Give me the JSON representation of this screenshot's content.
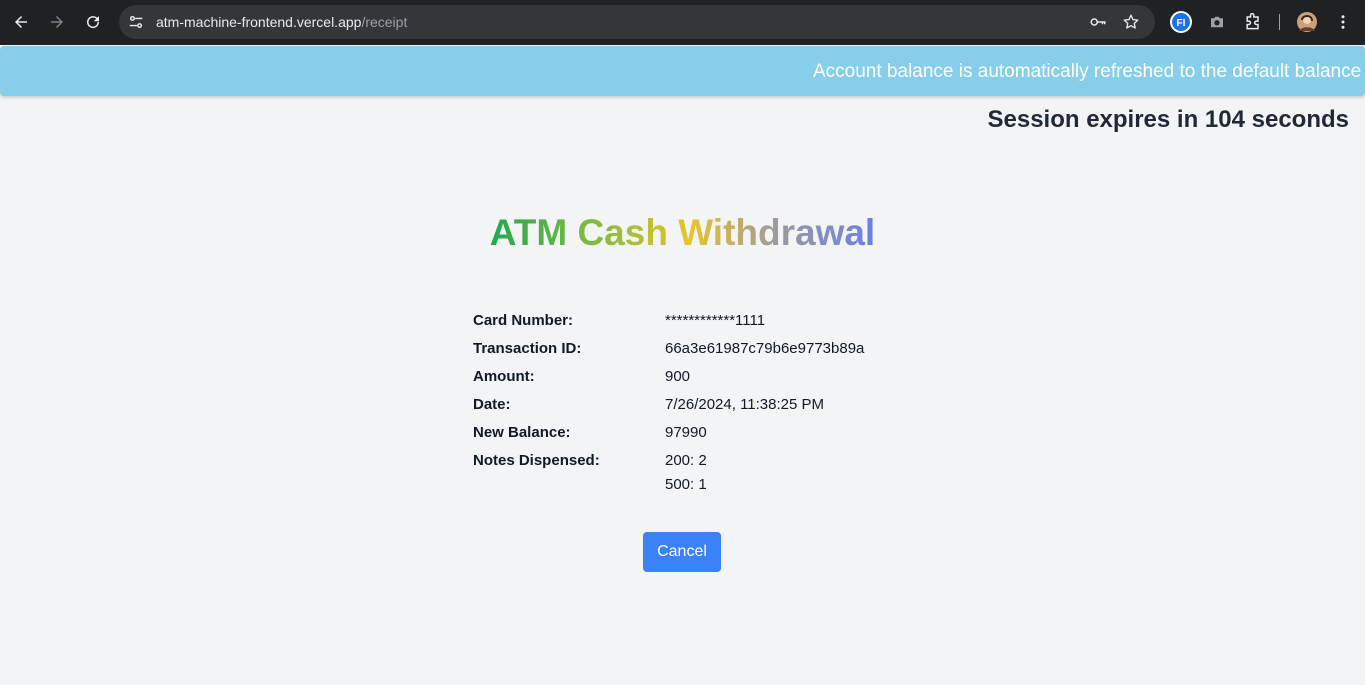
{
  "browser": {
    "url_host": "atm-machine-frontend.vercel.app",
    "url_path": "/receipt",
    "icons": [
      "back-icon",
      "forward-icon",
      "reload-icon",
      "site-info-icon",
      "key-icon",
      "star-icon",
      "extension-fi-icon",
      "camera-icon",
      "puzzle-icon",
      "profile-avatar",
      "menu-dots-icon"
    ]
  },
  "banner": {
    "text": "Account balance is automatically refreshed to the default balance"
  },
  "session": {
    "text": "Session expires in 104 seconds"
  },
  "title": "ATM Cash Withdrawal",
  "receipt": {
    "card_number_label": "Card Number:",
    "card_number_value": "************1111",
    "transaction_id_label": "Transaction ID:",
    "transaction_id_value": "66a3e61987c79b6e9773b89a",
    "amount_label": "Amount:",
    "amount_value": "900",
    "date_label": "Date:",
    "date_value": "7/26/2024, 11:38:25 PM",
    "new_balance_label": "New Balance:",
    "new_balance_value": "97990",
    "notes_label": "Notes Dispensed:",
    "notes": [
      "200: 2",
      "500: 1"
    ]
  },
  "cancel_label": "Cancel",
  "colors": {
    "banner": "#87ceeb",
    "button": "#3b82f6",
    "page_bg": "#f3f4f6"
  }
}
